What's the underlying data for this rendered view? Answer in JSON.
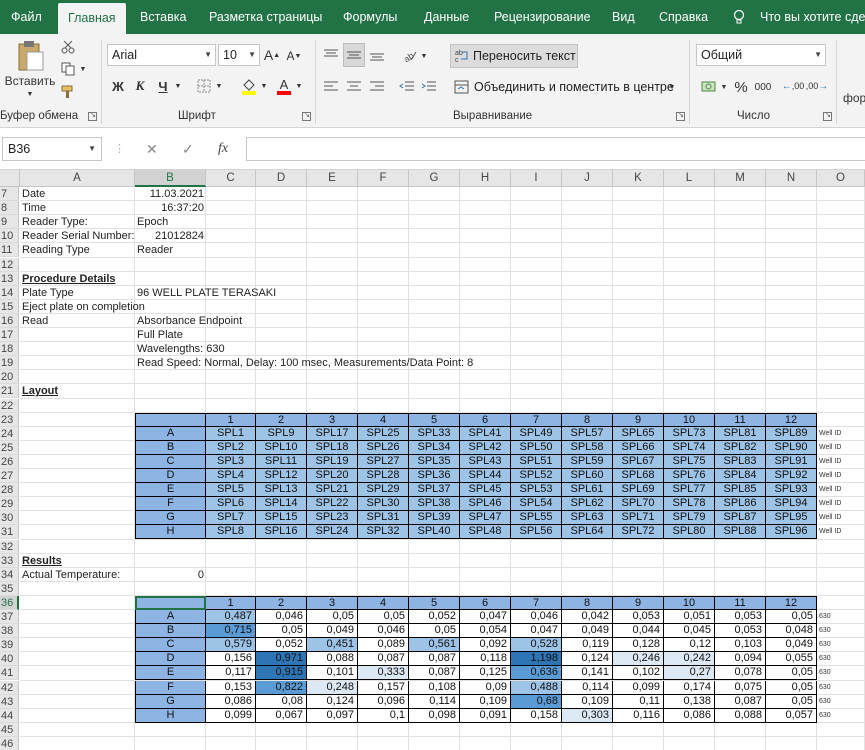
{
  "menu": {
    "tabs": [
      "Файл",
      "Главная",
      "Вставка",
      "Разметка страницы",
      "Формулы",
      "Данные",
      "Рецензирование",
      "Вид",
      "Справка"
    ],
    "active_tab": "Главная",
    "tell_me": "Что вы хотите сдел"
  },
  "ribbon": {
    "clipboard": {
      "paste_label": "Вставить",
      "group_label": "Буфер обмена"
    },
    "font": {
      "font_name": "Arial",
      "font_size": "10",
      "grow": "A",
      "shrink": "A",
      "bold": "Ж",
      "italic": "К",
      "underline": "Ч",
      "group_label": "Шрифт"
    },
    "alignment": {
      "wrap_text": "Переносить текст",
      "merge_center": "Объединить и поместить в центре",
      "group_label": "Выравнивание"
    },
    "number": {
      "format": "Общий",
      "percent": "%",
      "thousands": "000",
      "inc_decimal": ",00",
      "dec_decimal": ",00",
      "group_label": "Число"
    },
    "styles_partial": "фор"
  },
  "formula_bar": {
    "name_box": "B36",
    "cancel": "✕",
    "enter": "✓",
    "fx": "fx",
    "value": ""
  },
  "columns": [
    "A",
    "B",
    "C",
    "D",
    "E",
    "F",
    "G",
    "H",
    "I",
    "J",
    "K",
    "L",
    "M",
    "N",
    "O"
  ],
  "selected_column": "B",
  "selected_row": 36,
  "rows": [
    7,
    8,
    9,
    10,
    11,
    12,
    13,
    14,
    15,
    16,
    17,
    18,
    19,
    20,
    21,
    22,
    23,
    24,
    25,
    26,
    27,
    28,
    29,
    30,
    31,
    32,
    33,
    34,
    35,
    36,
    37,
    38,
    39,
    40,
    41,
    42,
    43,
    44,
    45,
    46
  ],
  "info": {
    "date_label": "Date",
    "date_value": "11.03.2021",
    "time_label": "Time",
    "time_value": "16:37:20",
    "reader_type_label": "Reader Type:",
    "reader_type_value": "Epoch",
    "serial_label": "Reader Serial Number:",
    "serial_value": "21012824",
    "reading_type_label": "Reading Type",
    "reading_type_value": "Reader",
    "procedure_header": "Procedure Details",
    "plate_type_label": "Plate Type",
    "plate_type_value": "96 WELL PLATE TERASAKI",
    "eject_label": "Eject plate on completion",
    "read_label": "Read",
    "read_value": "Absorbance Endpoint",
    "full_plate": "Full Plate",
    "wavelengths": "Wavelengths:  630",
    "read_speed": "Read Speed: Normal,  Delay: 100 msec,  Measurements/Data Point: 8",
    "layout_header": "Layout",
    "results_header": "Results",
    "temp_label": "Actual Temperature:",
    "temp_value": "0"
  },
  "plate_columns": [
    "1",
    "2",
    "3",
    "4",
    "5",
    "6",
    "7",
    "8",
    "9",
    "10",
    "11",
    "12"
  ],
  "plate_rows": [
    "A",
    "B",
    "C",
    "D",
    "E",
    "F",
    "G",
    "H"
  ],
  "layout_table": [
    [
      "SPL1",
      "SPL9",
      "SPL17",
      "SPL25",
      "SPL33",
      "SPL41",
      "SPL49",
      "SPL57",
      "SPL65",
      "SPL73",
      "SPL81",
      "SPL89"
    ],
    [
      "SPL2",
      "SPL10",
      "SPL18",
      "SPL26",
      "SPL34",
      "SPL42",
      "SPL50",
      "SPL58",
      "SPL66",
      "SPL74",
      "SPL82",
      "SPL90"
    ],
    [
      "SPL3",
      "SPL11",
      "SPL19",
      "SPL27",
      "SPL35",
      "SPL43",
      "SPL51",
      "SPL59",
      "SPL67",
      "SPL75",
      "SPL83",
      "SPL91"
    ],
    [
      "SPL4",
      "SPL12",
      "SPL20",
      "SPL28",
      "SPL36",
      "SPL44",
      "SPL52",
      "SPL60",
      "SPL68",
      "SPL76",
      "SPL84",
      "SPL92"
    ],
    [
      "SPL5",
      "SPL13",
      "SPL21",
      "SPL29",
      "SPL37",
      "SPL45",
      "SPL53",
      "SPL61",
      "SPL69",
      "SPL77",
      "SPL85",
      "SPL93"
    ],
    [
      "SPL6",
      "SPL14",
      "SPL22",
      "SPL30",
      "SPL38",
      "SPL46",
      "SPL54",
      "SPL62",
      "SPL70",
      "SPL78",
      "SPL86",
      "SPL94"
    ],
    [
      "SPL7",
      "SPL15",
      "SPL23",
      "SPL31",
      "SPL39",
      "SPL47",
      "SPL55",
      "SPL63",
      "SPL71",
      "SPL79",
      "SPL87",
      "SPL95"
    ],
    [
      "SPL8",
      "SPL16",
      "SPL24",
      "SPL32",
      "SPL40",
      "SPL48",
      "SPL56",
      "SPL64",
      "SPL72",
      "SPL80",
      "SPL88",
      "SPL96"
    ]
  ],
  "layout_suffix": "Well ID",
  "results_table": [
    [
      "0,487",
      "0,046",
      "0,05",
      "0,05",
      "0,052",
      "0,047",
      "0,046",
      "0,042",
      "0,053",
      "0,051",
      "0,053",
      "0,05"
    ],
    [
      "0,715",
      "0,05",
      "0,049",
      "0,046",
      "0,05",
      "0,054",
      "0,047",
      "0,049",
      "0,044",
      "0,045",
      "0,053",
      "0,048"
    ],
    [
      "0,579",
      "0,052",
      "0,451",
      "0,089",
      "0,561",
      "0,092",
      "0,528",
      "0,119",
      "0,128",
      "0,12",
      "0,103",
      "0,049"
    ],
    [
      "0,156",
      "0,971",
      "0,088",
      "0,087",
      "0,087",
      "0,118",
      "1,198",
      "0,124",
      "0,246",
      "0,242",
      "0,094",
      "0,055"
    ],
    [
      "0,117",
      "0,915",
      "0,101",
      "0,333",
      "0,087",
      "0,125",
      "0,636",
      "0,141",
      "0,102",
      "0,27",
      "0,078",
      "0,05"
    ],
    [
      "0,153",
      "0,822",
      "0,248",
      "0,157",
      "0,108",
      "0,09",
      "0,488",
      "0,114",
      "0,099",
      "0,174",
      "0,075",
      "0,05"
    ],
    [
      "0,086",
      "0,08",
      "0,124",
      "0,096",
      "0,114",
      "0,109",
      "0,68",
      "0,109",
      "0,11",
      "0,138",
      "0,087",
      "0,05"
    ],
    [
      "0,099",
      "0,067",
      "0,097",
      "0,1",
      "0,098",
      "0,091",
      "0,158",
      "0,303",
      "0,116",
      "0,086",
      "0,088",
      "0,057"
    ]
  ],
  "results_suffix": "630",
  "heat_colors": {
    "blank": "#ffffff",
    "low": "#dce9f5",
    "mid": "#9dc3e6",
    "high": "#5b9bd5",
    "max": "#2e75b6"
  }
}
